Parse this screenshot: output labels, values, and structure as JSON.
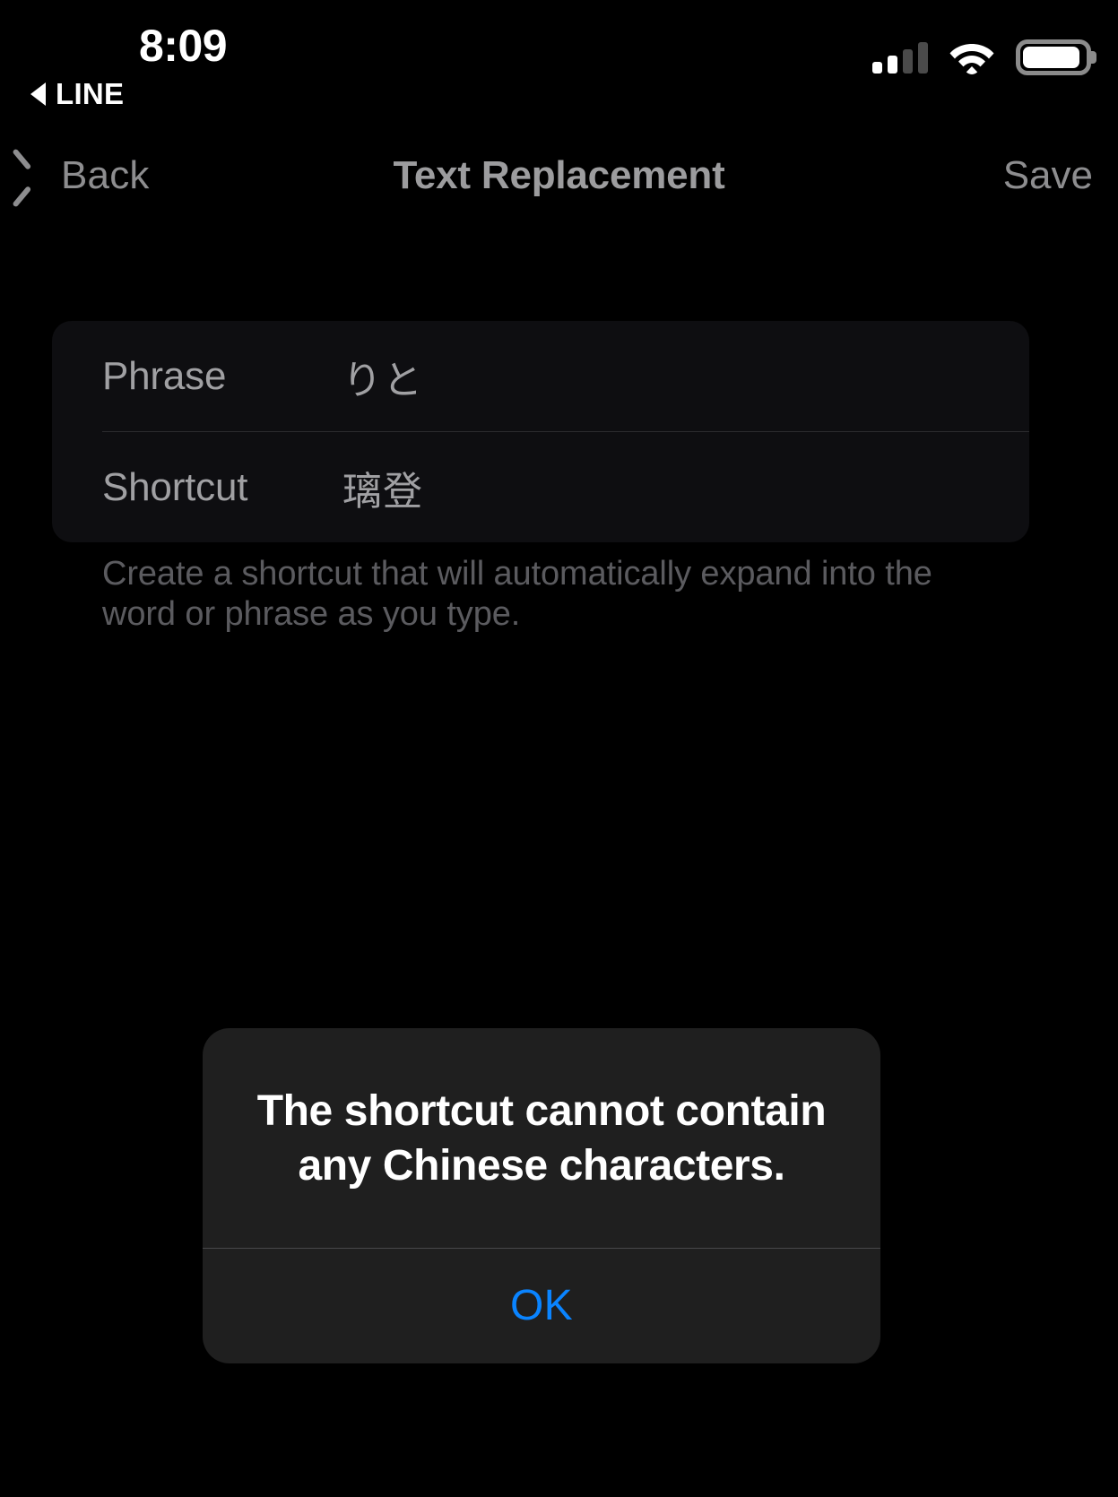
{
  "status_bar": {
    "time": "8:09",
    "back_app_label": "LINE",
    "icons": {
      "back_triangle": "back-triangle-icon",
      "cellular": "cellular-signal-icon",
      "wifi": "wifi-icon",
      "battery": "battery-icon"
    }
  },
  "nav_bar": {
    "back_label": "Back",
    "title": "Text Replacement",
    "save_label": "Save"
  },
  "form": {
    "rows": [
      {
        "label": "Phrase",
        "value": "りと"
      },
      {
        "label": "Shortcut",
        "value": "璃登"
      }
    ],
    "footer_note": "Create a shortcut that will automatically expand into the word or phrase as you type."
  },
  "alert": {
    "title": "The shortcut cannot contain any Chinese characters.",
    "ok_label": "OK"
  },
  "colors": {
    "background": "#000000",
    "card": "#0e0e11",
    "alert": "#1f1f1f",
    "accent_blue": "#0a84ff",
    "dim_text": "#8d8d8f",
    "note_text": "#5b5b5f"
  }
}
